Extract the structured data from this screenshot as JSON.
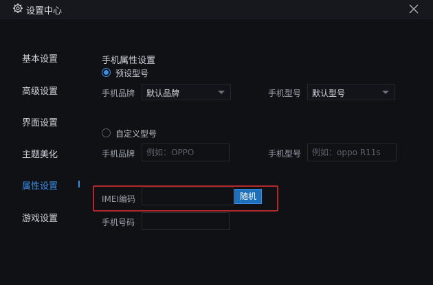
{
  "window": {
    "title": "设置中心",
    "icons": {
      "title": "gear-icon",
      "close": "close-icon"
    }
  },
  "sidebar": {
    "items": [
      {
        "label": "基本设置",
        "active": false
      },
      {
        "label": "高级设置",
        "active": false
      },
      {
        "label": "界面设置",
        "active": false
      },
      {
        "label": "主题美化",
        "active": false
      },
      {
        "label": "属性设置",
        "active": true
      },
      {
        "label": "游戏设置",
        "active": false
      }
    ]
  },
  "main": {
    "section_title": "手机属性设置",
    "preset": {
      "label": "预设型号",
      "checked": true,
      "brand_label": "手机品牌",
      "brand_value": "默认品牌",
      "model_label": "手机型号",
      "model_value": "默认型号"
    },
    "custom": {
      "label": "自定义型号",
      "checked": false,
      "brand_label": "手机品牌",
      "brand_placeholder": "例如：OPPO",
      "model_label": "手机型号",
      "model_placeholder": "例如：oppo R11s"
    },
    "imei": {
      "label": "IMEI编码",
      "value": "",
      "random_label": "随机"
    },
    "phone": {
      "label": "手机号码",
      "value": ""
    }
  },
  "colors": {
    "accent": "#3a8ee6",
    "background": "#0f1115",
    "highlight": "#b3282d",
    "button": "#1c6fb8"
  }
}
